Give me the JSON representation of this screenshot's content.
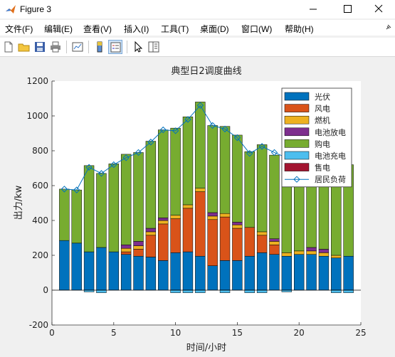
{
  "window": {
    "title": "Figure 3"
  },
  "menu": [
    "文件(F)",
    "编辑(E)",
    "查看(V)",
    "插入(I)",
    "工具(T)",
    "桌面(D)",
    "窗口(W)",
    "帮助(H)"
  ],
  "chart_data": {
    "type": "bar",
    "title": "典型日2调度曲线",
    "xlabel": "时间/小时",
    "ylabel": "出力/kw",
    "xlim": [
      0,
      25
    ],
    "ylim": [
      -200,
      1200
    ],
    "xticks": [
      0,
      5,
      10,
      15,
      20,
      25
    ],
    "yticks": [
      -200,
      0,
      200,
      400,
      600,
      800,
      1000,
      1200
    ],
    "legend_position": "top-right",
    "grid": false,
    "x": [
      1,
      2,
      3,
      4,
      5,
      6,
      7,
      8,
      9,
      10,
      11,
      12,
      13,
      14,
      15,
      16,
      17,
      18,
      19,
      20,
      21,
      22,
      23,
      24
    ],
    "stacked_series": [
      {
        "name": "光伏",
        "color": "#0072BD",
        "values": [
          285,
          270,
          220,
          245,
          220,
          205,
          195,
          190,
          170,
          215,
          220,
          195,
          140,
          170,
          170,
          195,
          215,
          205,
          195,
          205,
          205,
          195,
          185,
          195
        ]
      },
      {
        "name": "风电",
        "color": "#D95319",
        "values": [
          0,
          0,
          0,
          0,
          0,
          15,
          40,
          125,
          210,
          195,
          250,
          370,
          265,
          250,
          185,
          165,
          100,
          55,
          0,
          0,
          0,
          0,
          0,
          0
        ]
      },
      {
        "name": "燃机",
        "color": "#EDB120",
        "values": [
          0,
          0,
          0,
          0,
          0,
          20,
          20,
          20,
          20,
          20,
          20,
          20,
          20,
          20,
          20,
          0,
          20,
          20,
          20,
          20,
          20,
          20,
          15,
          0
        ]
      },
      {
        "name": "电池放电",
        "color": "#7E2F8E",
        "values": [
          0,
          0,
          0,
          0,
          0,
          20,
          25,
          20,
          15,
          0,
          0,
          0,
          20,
          0,
          15,
          0,
          0,
          15,
          0,
          0,
          20,
          20,
          0,
          0
        ]
      },
      {
        "name": "购电",
        "color": "#77AC30",
        "values": [
          295,
          305,
          495,
          425,
          505,
          520,
          510,
          500,
          505,
          500,
          505,
          495,
          500,
          500,
          500,
          435,
          500,
          480,
          560,
          545,
          545,
          530,
          535,
          525
        ]
      },
      {
        "name": "电池充电",
        "color": "#4DBEEE",
        "values": [
          0,
          0,
          -10,
          -15,
          0,
          0,
          0,
          0,
          0,
          -15,
          -15,
          -15,
          0,
          -15,
          0,
          -15,
          -15,
          0,
          -10,
          0,
          0,
          0,
          -15,
          -15
        ]
      },
      {
        "name": "售电",
        "color": "#A2142F",
        "values": [
          0,
          0,
          0,
          0,
          0,
          0,
          0,
          0,
          0,
          0,
          0,
          0,
          0,
          0,
          0,
          0,
          0,
          0,
          0,
          0,
          0,
          0,
          0,
          0
        ]
      }
    ],
    "line_series": {
      "name": "居民负荷",
      "color": "#0072BD",
      "values": [
        580,
        575,
        705,
        670,
        720,
        760,
        790,
        850,
        920,
        915,
        980,
        1060,
        945,
        925,
        875,
        785,
        825,
        790,
        760,
        740,
        730,
        720,
        690,
        700
      ]
    }
  }
}
